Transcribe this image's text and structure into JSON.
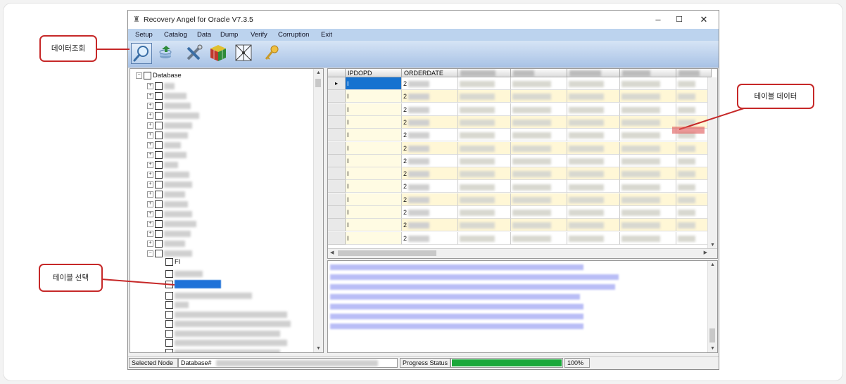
{
  "window": {
    "title": "Recovery Angel for Oracle V7.3.5",
    "minimize": "–",
    "maximize": "☐",
    "close": "✕"
  },
  "menu": [
    "Setup",
    "Catalog",
    "Data",
    "Dump",
    "Verify",
    "Corruption",
    "Exit"
  ],
  "toolbar": {
    "buttons": [
      "search-icon",
      "database-export-icon",
      "tools-icon",
      "cube-icon",
      "network-icon",
      "key-icon"
    ]
  },
  "tree": {
    "root_label": "Database",
    "child_prefix_label": "FI"
  },
  "grid": {
    "columns": [
      "IPDOPD",
      "ORDERDATE"
    ],
    "row_pointer": "▸",
    "cell_col1": "I",
    "cell_col2": "2"
  },
  "statusbar": {
    "selected_node_label": "Selected Node",
    "selected_node_value": "Database#",
    "progress_label": "Progress Status",
    "progress_value": "100%",
    "progress_fraction": 1.0
  },
  "callouts": {
    "data_query": "데이터조회",
    "table_data": "테이블 데이터",
    "table_select": "테이블 선택"
  },
  "colors": {
    "callout_border": "#c62828",
    "progress_fill": "#1aa83a",
    "selected_cell": "#1572d0",
    "row_highlight": "#fff7d6"
  }
}
